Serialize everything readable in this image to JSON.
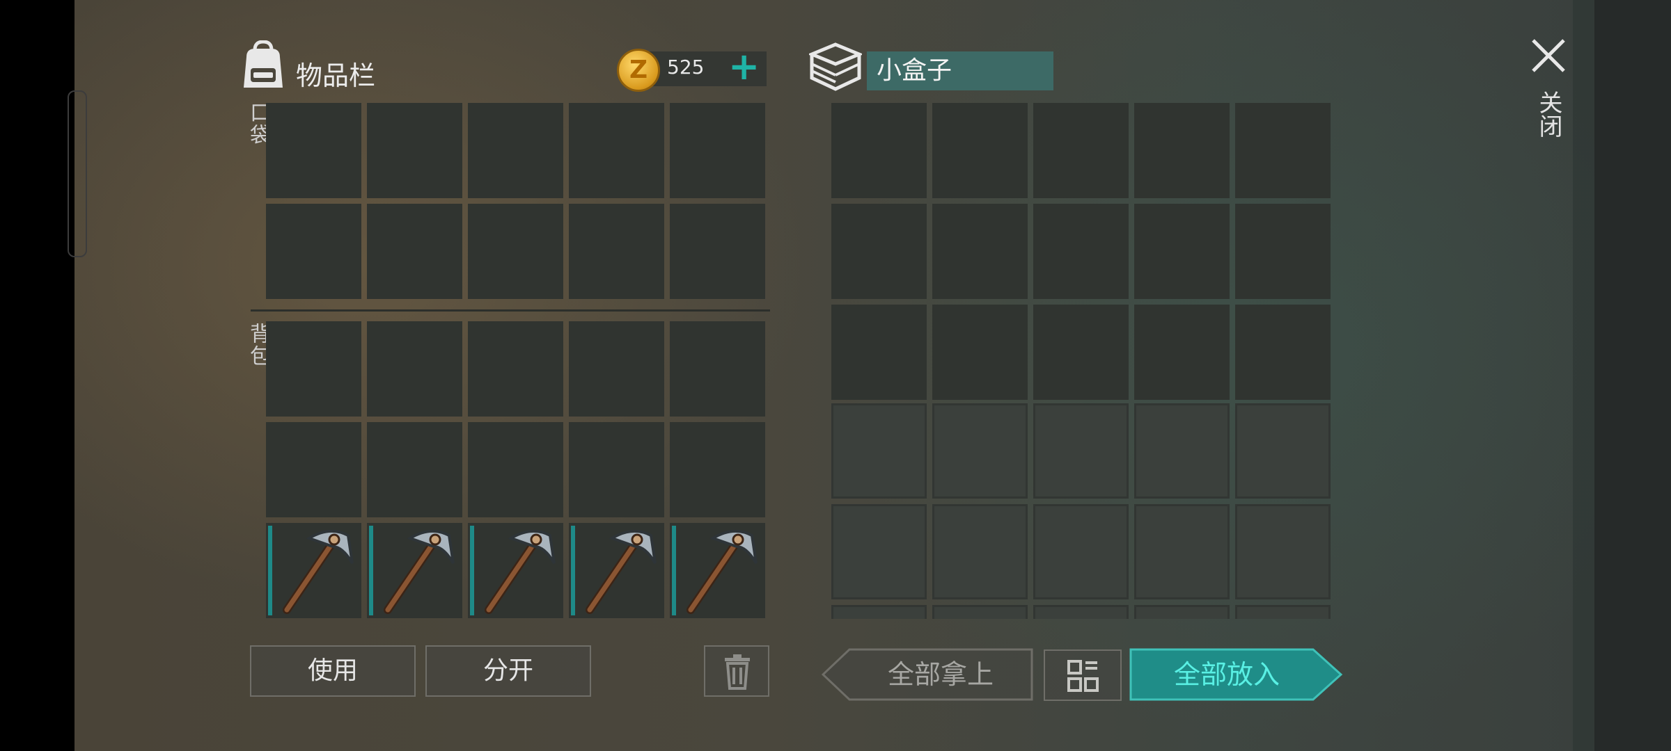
{
  "inventory": {
    "title": "物品栏",
    "pocket_label": "口袋",
    "backpack_label": "背包",
    "currency_amount": "525",
    "item_slots": [
      {
        "item": "pickaxe-icon"
      },
      {
        "item": "pickaxe-icon"
      },
      {
        "item": "pickaxe-icon"
      },
      {
        "item": "pickaxe-icon"
      },
      {
        "item": "pickaxe-icon"
      }
    ]
  },
  "container": {
    "title": "小盒子"
  },
  "buttons": {
    "use": "使用",
    "split": "分开",
    "take_all": "全部拿上",
    "put_all": "全部放入"
  },
  "close_label": "关闭",
  "colors": {
    "accent": "#1fb3a6",
    "slot": "#303430",
    "name_field": "#3d6a66"
  }
}
